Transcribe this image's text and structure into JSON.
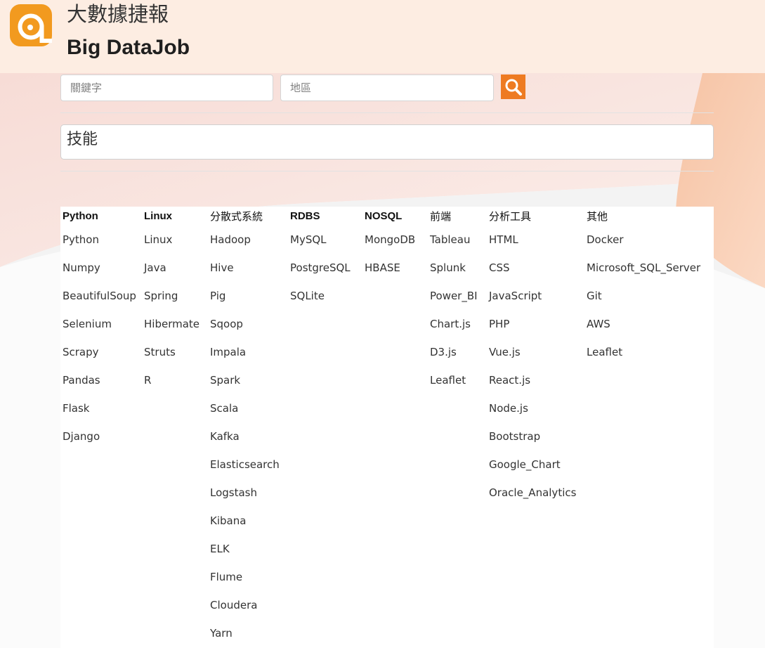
{
  "header": {
    "title_zh": "大數據捷報",
    "title_en": "Big DataJob"
  },
  "search": {
    "keyword_placeholder": "關鍵字",
    "location_placeholder": "地區"
  },
  "skills_title": "技能",
  "colors": {
    "header_bg": "#fdede2",
    "accent": "#ee7b22",
    "logo": "#f29a1f"
  },
  "columns": [
    {
      "header": "Python",
      "items": [
        "Python",
        "Numpy",
        "BeautifulSoup",
        "Selenium",
        "Scrapy",
        "Pandas",
        "Flask",
        "Django"
      ]
    },
    {
      "header": "Linux",
      "items": [
        "Linux",
        "Java",
        "Spring",
        "Hibermate",
        "Struts",
        "R"
      ]
    },
    {
      "header": "分散式系統",
      "items": [
        "Hadoop",
        "Hive",
        "Pig",
        "Sqoop",
        "Impala",
        "Spark",
        "Scala",
        "Kafka",
        "Elasticsearch",
        "Logstash",
        "Kibana",
        "ELK",
        "Flume",
        "Cloudera",
        "Yarn"
      ]
    },
    {
      "header": "RDBS",
      "items": [
        "MySQL",
        "PostgreSQL",
        "SQLite"
      ]
    },
    {
      "header": "NOSQL",
      "items": [
        "MongoDB",
        "HBASE"
      ]
    },
    {
      "header": "前端",
      "items": [
        "Tableau",
        "Splunk",
        "Power_BI",
        "Chart.js",
        "D3.js",
        "Leaflet"
      ]
    },
    {
      "header": "分析工具",
      "items": [
        "HTML",
        "CSS",
        "JavaScript",
        "PHP",
        "Vue.js",
        "React.js",
        "Node.js",
        "Bootstrap",
        "Google_Chart",
        "Oracle_Analytics"
      ]
    },
    {
      "header": "其他",
      "items": [
        "Docker",
        "Microsoft_SQL_Server",
        "Git",
        "AWS",
        "Leaflet"
      ]
    }
  ]
}
